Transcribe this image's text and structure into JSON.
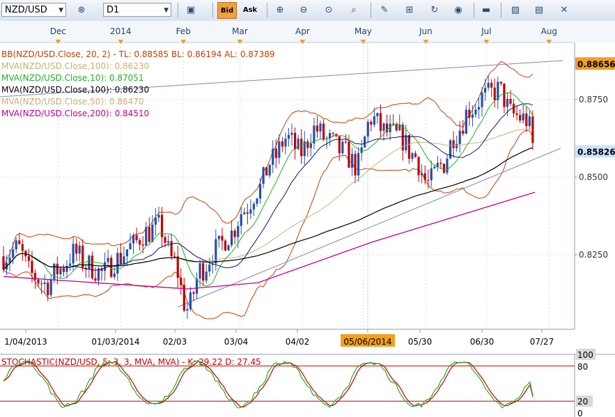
{
  "toolbar": {
    "symbol": "NZD/USD",
    "timeframe": "D1",
    "bid_label": "Bid",
    "ask_label": "Ask",
    "icons": [
      "symbol-dropdown",
      "favorites-icon",
      "chart-type-icon",
      "bid-button",
      "ask-button",
      "zoom-in-icon",
      "zoom-out-icon",
      "zoom-reset-icon",
      "cursor-icon",
      "drawing-icon",
      "refresh-icon",
      "globe-icon",
      "ruler-icon",
      "image-icon",
      "template-icon",
      "tools-icon"
    ]
  },
  "legend": [
    {
      "text": "BB(NZD/USD.Close, 20, 2) -   TL: 0.88585   BL: 0.86194   AL: 0.87389",
      "color": "#c04000"
    },
    {
      "text": "MVA(NZD/USD.Close,100): 0.86230",
      "color": "#c8b070"
    },
    {
      "text": "MVA(NZD/USD.Close,10): 0.87051",
      "color": "#20b020"
    },
    {
      "text": "MVA(NZD/USD.Close,100): 0.86230",
      "color": "#000000"
    },
    {
      "text": "MVA(NZD/USD.Close,50): 0.86470",
      "color": "#c8b070"
    },
    {
      "text": "MVA(NZD/USD.Close,200): 0.84510",
      "color": "#c0008a"
    }
  ],
  "price_labels": {
    "high": "0.88656",
    "current": "0.85826",
    "high_value": 0.88656,
    "current_value": 0.85826
  },
  "top_months": [
    "Dec",
    "2014",
    "Feb",
    "Mar",
    "Apr",
    "May",
    "Jun",
    "Jul",
    "Aug"
  ],
  "bottom_dates": [
    "1/04/2013",
    "01/03/2014",
    "02/03",
    "03/04",
    "04/02",
    "05/06/2014",
    "05/30",
    "06/30",
    "07/27"
  ],
  "stochastic": {
    "label": "STOCHASTIC(NZD/USD, 5, 3, 3, MVA, MVA) -   K: 29.22   D: 27.45",
    "k_value": 29.22,
    "d_value": 27.45,
    "axis_ticks": [
      "100",
      "80",
      "20",
      "0"
    ]
  },
  "colors": {
    "up": "#2050b0",
    "down": "#c00000",
    "bb": "#c04000",
    "ma10": "#20b020",
    "ma20": "#101070",
    "ma50": "#c8b070",
    "ma100": "#000000",
    "ma200": "#c0008a",
    "stoch_k": "#20b020",
    "stoch_d": "#c00000"
  },
  "chart_data": {
    "type": "line",
    "title": "",
    "symbol": "NZD/USD",
    "timeframe": "D1",
    "y_ticks": [
      0.825,
      0.85,
      0.875
    ],
    "y_tick_labels": [
      "0.8250",
      "0.8500",
      "0.8750"
    ],
    "ylim": [
      0.801,
      0.892
    ],
    "close_series": [
      [
        "2013-11-04",
        0.8245
      ],
      [
        "2013-11-11",
        0.827
      ],
      [
        "2013-11-18",
        0.8185
      ],
      [
        "2013-11-25",
        0.8155
      ],
      [
        "2013-12-02",
        0.8205
      ],
      [
        "2013-12-09",
        0.8255
      ],
      [
        "2013-12-16",
        0.8215
      ],
      [
        "2013-12-23",
        0.819
      ],
      [
        "2013-12-30",
        0.8235
      ],
      [
        "2014-01-06",
        0.8275
      ],
      [
        "2014-01-13",
        0.832
      ],
      [
        "2014-01-20",
        0.834
      ],
      [
        "2014-01-27",
        0.823
      ],
      [
        "2014-02-03",
        0.8075
      ],
      [
        "2014-02-10",
        0.8205
      ],
      [
        "2014-02-17",
        0.8265
      ],
      [
        "2014-02-24",
        0.8315
      ],
      [
        "2014-03-03",
        0.8395
      ],
      [
        "2014-03-10",
        0.846
      ],
      [
        "2014-03-17",
        0.8555
      ],
      [
        "2014-03-24",
        0.8625
      ],
      [
        "2014-03-31",
        0.858
      ],
      [
        "2014-04-07",
        0.8655
      ],
      [
        "2014-04-14",
        0.8615
      ],
      [
        "2014-04-21",
        0.858
      ],
      [
        "2014-04-28",
        0.8535
      ],
      [
        "2014-05-05",
        0.869
      ],
      [
        "2014-05-12",
        0.8645
      ],
      [
        "2014-05-19",
        0.863
      ],
      [
        "2014-05-26",
        0.857
      ],
      [
        "2014-06-02",
        0.848
      ],
      [
        "2014-06-09",
        0.854
      ],
      [
        "2014-06-16",
        0.8645
      ],
      [
        "2014-06-23",
        0.872
      ],
      [
        "2014-06-30",
        0.876
      ],
      [
        "2014-07-07",
        0.878
      ],
      [
        "2014-07-14",
        0.87
      ],
      [
        "2014-07-21",
        0.8685
      ],
      [
        "2014-07-25",
        0.8583
      ]
    ],
    "ma_200_series": [
      [
        "2013-11-04",
        0.818
      ],
      [
        "2014-02-03",
        0.814
      ],
      [
        "2014-03-10",
        0.816
      ],
      [
        "2014-05-05",
        0.829
      ],
      [
        "2014-07-25",
        0.8451
      ]
    ],
    "stochastic_levels": [
      20,
      80
    ]
  }
}
